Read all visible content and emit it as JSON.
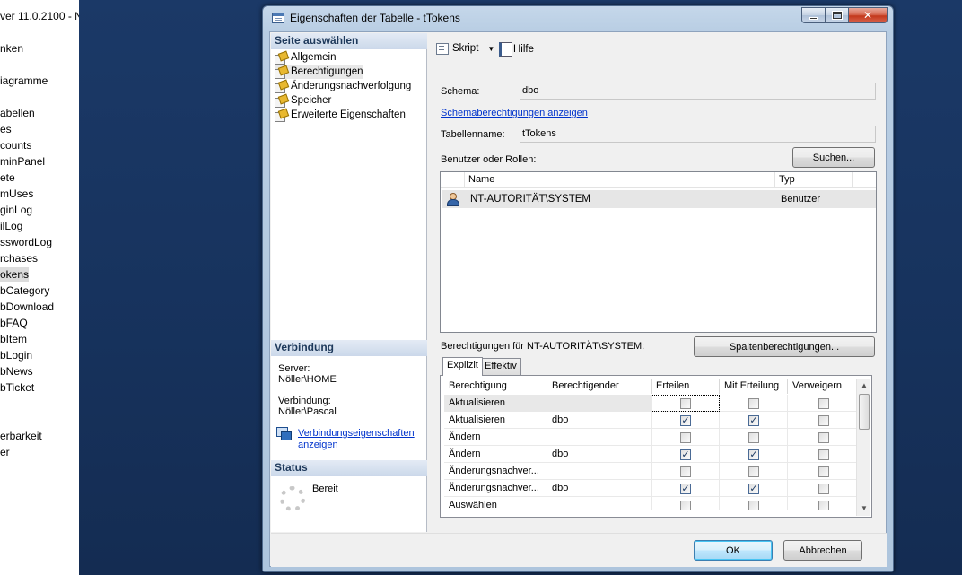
{
  "explorer": {
    "items": [
      {
        "label": "ver 11.0.2100 - N",
        "selected": false
      },
      {
        "label": "nken",
        "selected": false
      },
      {
        "label": "iagramme",
        "selected": false
      },
      {
        "label": "abellen",
        "selected": false
      },
      {
        "label": "es",
        "selected": false
      },
      {
        "label": "counts",
        "selected": false
      },
      {
        "label": "minPanel",
        "selected": false
      },
      {
        "label": "ete",
        "selected": false
      },
      {
        "label": "mUses",
        "selected": false
      },
      {
        "label": "ginLog",
        "selected": false
      },
      {
        "label": "ilLog",
        "selected": false
      },
      {
        "label": "sswordLog",
        "selected": false
      },
      {
        "label": "rchases",
        "selected": false
      },
      {
        "label": "okens",
        "selected": true
      },
      {
        "label": "bCategory",
        "selected": false
      },
      {
        "label": "bDownload",
        "selected": false
      },
      {
        "label": "bFAQ",
        "selected": false
      },
      {
        "label": "bItem",
        "selected": false
      },
      {
        "label": "bLogin",
        "selected": false
      },
      {
        "label": "bNews",
        "selected": false
      },
      {
        "label": "bTicket",
        "selected": false
      },
      {
        "label": "erbarkeit",
        "selected": false
      },
      {
        "label": "er",
        "selected": false
      }
    ]
  },
  "window": {
    "title": "Eigenschaften der Tabelle - tTokens",
    "icon": "table-properties-icon",
    "controls": {
      "minimize": "minimize-icon",
      "maximize": "maximize-icon",
      "close": "✕"
    }
  },
  "left_pane": {
    "select_page_header": "Seite auswählen",
    "pages": [
      {
        "label": "Allgemein",
        "selected": false
      },
      {
        "label": "Berechtigungen",
        "selected": true
      },
      {
        "label": "Änderungsnachverfolgung",
        "selected": false
      },
      {
        "label": "Speicher",
        "selected": false
      },
      {
        "label": "Erweiterte Eigenschaften",
        "selected": false
      }
    ],
    "connection_header": "Verbindung",
    "server_label": "Server:",
    "server_value": "Nöller\\HOME",
    "connection_label": "Verbindung:",
    "connection_value": "Nöller\\Pascal",
    "connection_properties_link_line1": "Verbindungseigenschaften",
    "connection_properties_link_line2": "anzeigen",
    "status_header": "Status",
    "status_value": "Bereit"
  },
  "toolbar": {
    "script_label": "Skript",
    "script_dropdown": "▼",
    "help_label": "Hilfe"
  },
  "form": {
    "schema_label": "Schema:",
    "schema_value": "dbo",
    "schema_permissions_link": "Schemaberechtigungen anzeigen",
    "table_name_label": "Tabellenname:",
    "table_name_value": "tTokens",
    "users_roles_label": "Benutzer oder Rollen:",
    "search_button": "Suchen...",
    "users_columns": {
      "name": "Name",
      "type": "Typ"
    },
    "users": [
      {
        "name": "NT-AUTORITÄT\\SYSTEM",
        "type": "Benutzer"
      }
    ],
    "permissions_for_label": "Berechtigungen für NT-AUTORITÄT\\SYSTEM:",
    "column_permissions_button": "Spaltenberechtigungen...",
    "tabs": [
      {
        "label": "Explizit",
        "active": true
      },
      {
        "label": "Effektiv",
        "active": false
      }
    ],
    "perm_columns": {
      "permission": "Berechtigung",
      "grantor": "Berechtigender",
      "grant": "Erteilen",
      "with_grant": "Mit Erteilung",
      "deny": "Verweigern"
    },
    "permissions": [
      {
        "permission": "Aktualisieren",
        "grantor": "",
        "grant": false,
        "with_grant": false,
        "deny": false
      },
      {
        "permission": "Aktualisieren",
        "grantor": "dbo",
        "grant": true,
        "with_grant": true,
        "deny": false
      },
      {
        "permission": "Ändern",
        "grantor": "",
        "grant": false,
        "with_grant": false,
        "deny": false
      },
      {
        "permission": "Ändern",
        "grantor": "dbo",
        "grant": true,
        "with_grant": true,
        "deny": false
      },
      {
        "permission": "Änderungsnachver...",
        "grantor": "",
        "grant": false,
        "with_grant": false,
        "deny": false
      },
      {
        "permission": "Änderungsnachver...",
        "grantor": "dbo",
        "grant": true,
        "with_grant": true,
        "deny": false
      },
      {
        "permission": "Auswählen",
        "grantor": "",
        "grant": false,
        "with_grant": false,
        "deny": false
      }
    ]
  },
  "buttons": {
    "ok": "OK",
    "cancel": "Abbrechen"
  },
  "scrollbar": {
    "up": "▲",
    "down": "▼"
  },
  "check_glyph": "✓"
}
